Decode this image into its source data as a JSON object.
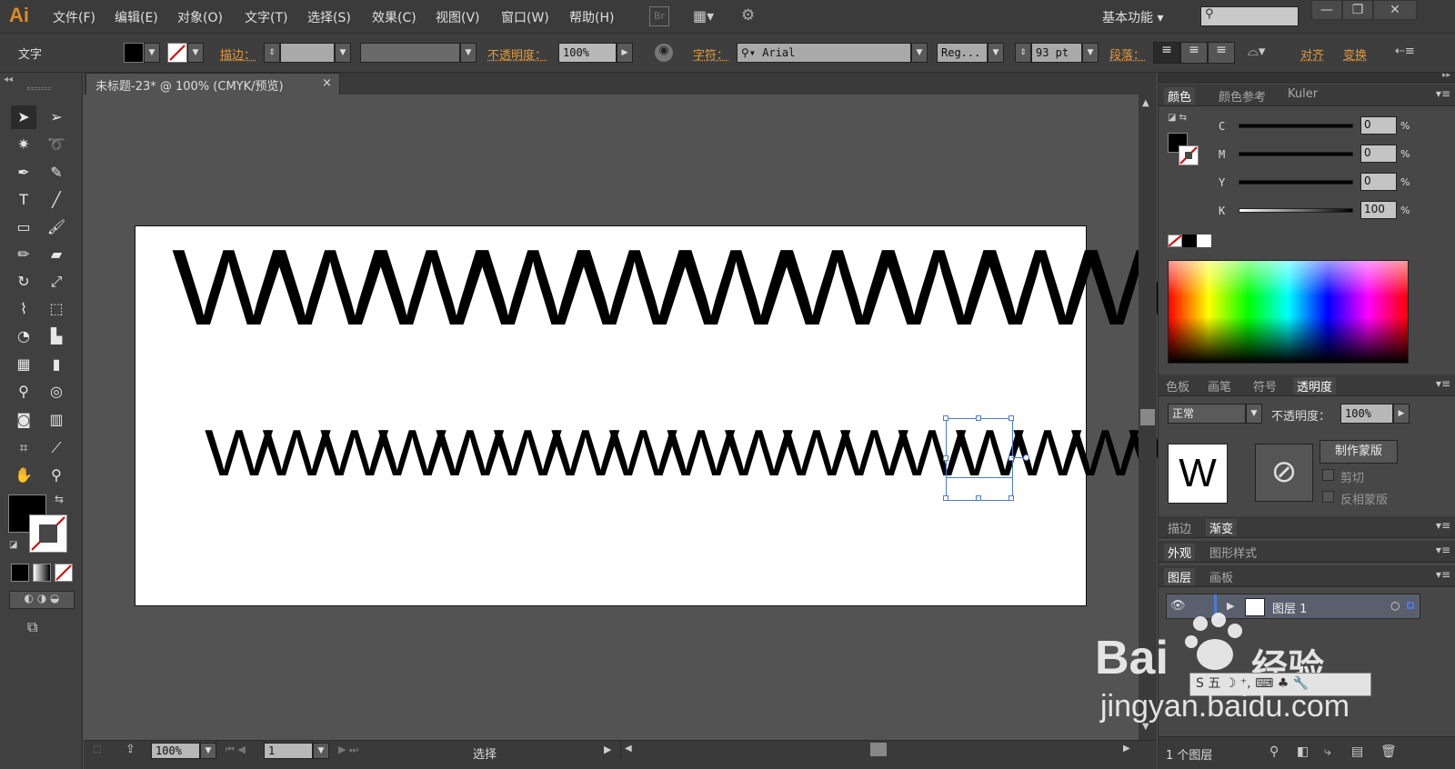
{
  "app": {
    "logo": "Ai"
  },
  "menu": [
    "文件(F)",
    "编辑(E)",
    "对象(O)",
    "文字(T)",
    "选择(S)",
    "效果(C)",
    "视图(V)",
    "窗口(W)",
    "帮助(H)"
  ],
  "bridge_label": "Br",
  "workspace": "基本功能",
  "window_buttons": [
    "—",
    "❐",
    "✕"
  ],
  "control": {
    "selection_type": "文字",
    "stroke_label": "描边：",
    "opacity_label": "不透明度：",
    "opacity_value": "100%",
    "char_label": "字符：",
    "font_family": "Arial",
    "font_style": "Reg...",
    "font_size": "93 pt",
    "para_label": "段落：",
    "align_label": "对齐",
    "transform_label": "变换"
  },
  "document": {
    "tab_title": "未标题-23* @ 100% (CMYK/预览)",
    "close": "×"
  },
  "artboard": {
    "line1": "WWWWWWWWWW",
    "line2": "WWWWWWWWWWWWWWWWWWWW"
  },
  "status": {
    "zoom": "100%",
    "page": "1",
    "tool": "选择"
  },
  "color_panel": {
    "tabs": [
      "颜色",
      "颜色参考",
      "Kuler"
    ],
    "channels": [
      {
        "name": "C",
        "value": "0"
      },
      {
        "name": "M",
        "value": "0"
      },
      {
        "name": "Y",
        "value": "0"
      },
      {
        "name": "K",
        "value": "100"
      }
    ],
    "pct": "%"
  },
  "transparency_panel": {
    "tabs": [
      "色板",
      "画笔",
      "符号",
      "透明度"
    ],
    "blend_mode": "正常",
    "opacity_label": "不透明度：",
    "opacity_value": "100%",
    "thumb_letter": "W",
    "make_mask": "制作蒙版",
    "clip": "剪切",
    "invert": "反相蒙版"
  },
  "stroke_tabs": [
    "描边",
    "渐变"
  ],
  "appearance_tabs": [
    "外观",
    "图形样式"
  ],
  "layers_panel": {
    "tabs": [
      "图层",
      "画板"
    ],
    "layer_name": "图层 1",
    "footer": "1 个图层"
  },
  "watermark": {
    "brand": "Bai",
    "suffix": "经验",
    "url": "jingyan.baidu.com"
  },
  "colors": {
    "accent": "#e39b3a",
    "selection": "#4b7bd6"
  }
}
